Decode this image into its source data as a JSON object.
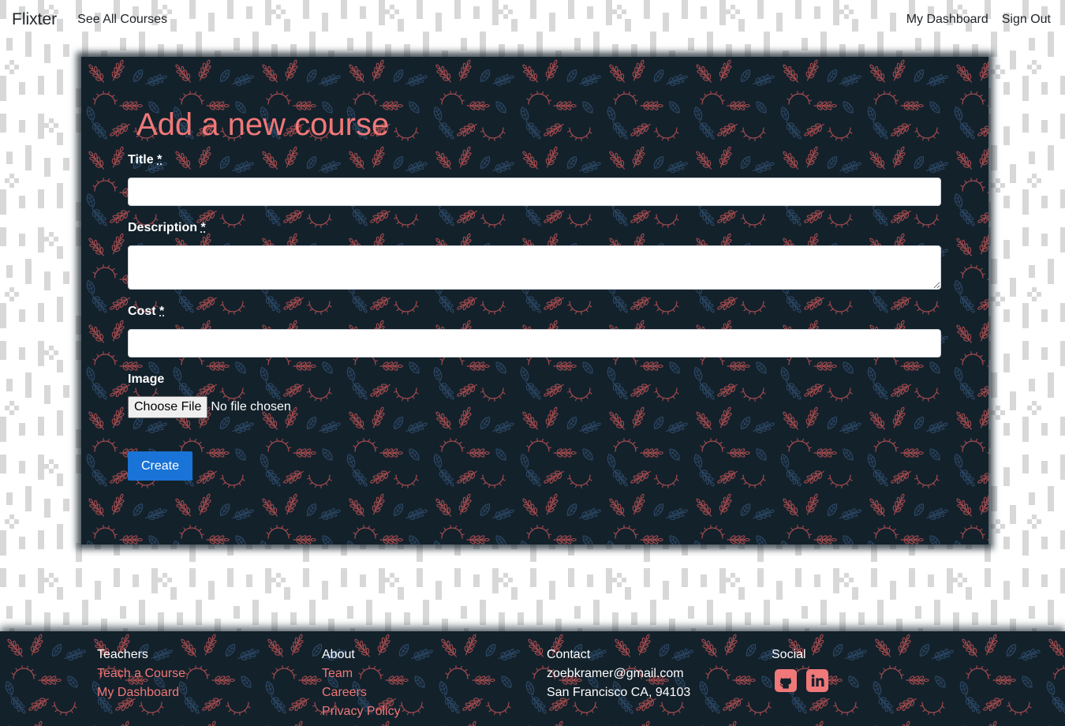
{
  "colors": {
    "accent": "#f07878",
    "panel": "#13212b",
    "primary": "#1a73d6",
    "page": "#ffffff"
  },
  "nav": {
    "brand": "Flixter",
    "see_all_courses": "See All Courses",
    "my_dashboard": "My Dashboard",
    "sign_out": "Sign Out"
  },
  "form": {
    "heading": "Add a new course",
    "fields": {
      "title": {
        "label": "Title",
        "required_mark": "*"
      },
      "description": {
        "label": "Description",
        "required_mark": "*"
      },
      "cost": {
        "label": "Cost",
        "required_mark": "*"
      },
      "image": {
        "label": "Image",
        "button_label": "Choose File",
        "status": "No file chosen"
      }
    },
    "submit_label": "Create"
  },
  "footer": {
    "teachers": {
      "heading": "Teachers",
      "links": [
        "Teach a Course",
        "My Dashboard"
      ]
    },
    "about": {
      "heading": "About",
      "links": [
        "Team",
        "Careers",
        "Privacy Policy"
      ]
    },
    "contact": {
      "heading": "Contact",
      "email": "zoebkramer@gmail.com",
      "address": "San Francisco CA, 94103"
    },
    "social": {
      "heading": "Social",
      "icons": [
        "github-icon",
        "linkedin-icon"
      ]
    }
  }
}
